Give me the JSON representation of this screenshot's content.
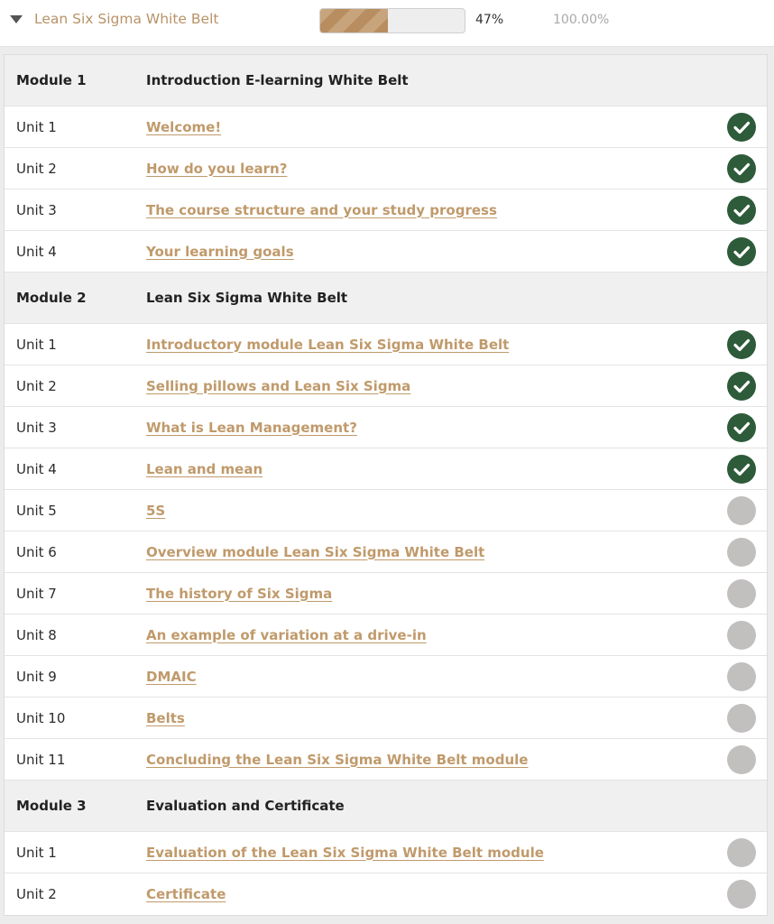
{
  "course": {
    "title": "Lean Six Sigma White Belt",
    "progress_label": "47%",
    "progress_fraction": 0.47,
    "completion_label": "100.00%",
    "toggle_icon": "triangle-down-icon"
  },
  "colors": {
    "link": "#c09a6b",
    "done": "#2e5b3a",
    "todo": "#c2bfbf",
    "module_bg": "#f0f0f0"
  },
  "modules": [
    {
      "label": "Module 1",
      "title": "Introduction E-learning White Belt",
      "units": [
        {
          "label": "Unit 1",
          "title": "Welcome!",
          "completed": true
        },
        {
          "label": "Unit 2",
          "title": "How do you learn?",
          "completed": true
        },
        {
          "label": "Unit 3",
          "title": "The course structure and your study progress",
          "completed": true
        },
        {
          "label": "Unit 4",
          "title": "Your learning goals",
          "completed": true
        }
      ]
    },
    {
      "label": "Module 2",
      "title": "Lean Six Sigma White Belt",
      "units": [
        {
          "label": "Unit 1",
          "title": "Introductory module Lean Six Sigma White Belt",
          "completed": true
        },
        {
          "label": "Unit 2",
          "title": "Selling pillows and Lean Six Sigma",
          "completed": true
        },
        {
          "label": "Unit 3",
          "title": "What is Lean Management?",
          "completed": true
        },
        {
          "label": "Unit 4",
          "title": "Lean and mean",
          "completed": true
        },
        {
          "label": "Unit 5",
          "title": "5S",
          "completed": false
        },
        {
          "label": "Unit 6",
          "title": "Overview module Lean Six Sigma White Belt",
          "completed": false
        },
        {
          "label": "Unit 7",
          "title": "The history of Six Sigma",
          "completed": false
        },
        {
          "label": "Unit 8",
          "title": "An example of variation at a drive-in",
          "completed": false
        },
        {
          "label": "Unit 9",
          "title": "DMAIC",
          "completed": false
        },
        {
          "label": "Unit 10",
          "title": "Belts",
          "completed": false
        },
        {
          "label": "Unit 11",
          "title": "Concluding the Lean Six Sigma White Belt module",
          "completed": false
        }
      ]
    },
    {
      "label": "Module 3",
      "title": "Evaluation and Certificate",
      "units": [
        {
          "label": "Unit 1",
          "title": "Evaluation of the Lean Six Sigma White Belt module",
          "completed": false
        },
        {
          "label": "Unit 2",
          "title": "Certificate",
          "completed": false
        }
      ]
    }
  ]
}
